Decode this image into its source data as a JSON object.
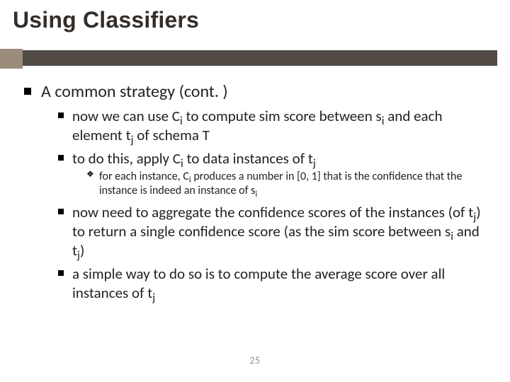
{
  "title": "Using Classifiers",
  "bullets": {
    "top": "A common strategy (cont. )",
    "s1_a_pre": "now we can use ",
    "s1_a_c": "C",
    "s1_a_mid1": " to compute sim score between ",
    "s1_a_s": "s",
    "s1_a_mid2": " and each element ",
    "s1_a_t": "t",
    "s1_a_end": " of schema T",
    "s1_b_pre": "to do this, apply ",
    "s1_b_mid": " to data instances of ",
    "s2_a_pre": "for each instance, ",
    "s2_a_mid1": " produces a number in [0, 1] that is the confidence that the instance is indeed an instance of ",
    "s1_c_pre": "now need to aggregate the confidence scores of the instances (of ",
    "s1_c_mid1": ") to return a single confidence score (as the sim score between ",
    "s1_c_mid2": " and ",
    "s1_c_end": ")",
    "s1_d_pre": "a simple way to do so is to compute the average score over all instances of ",
    "idx_i": "i",
    "idx_j": "j"
  },
  "page_number": "25"
}
